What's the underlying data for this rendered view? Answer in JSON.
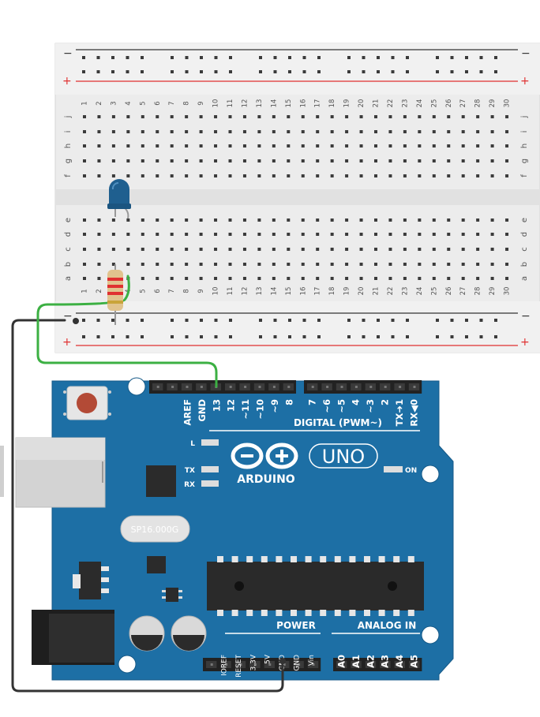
{
  "breadboard": {
    "columns": 30,
    "rows_top": [
      "j",
      "i",
      "h",
      "g",
      "f"
    ],
    "rows_bottom": [
      "e",
      "d",
      "c",
      "b",
      "a"
    ],
    "rail_minus": "−",
    "rail_plus": "+"
  },
  "components": {
    "led": {
      "color": "#1f5f8f",
      "name": "LED"
    },
    "resistor": {
      "name": "Resistor"
    }
  },
  "arduino": {
    "logo_text": "ARDUINO",
    "uno_text": "UNO",
    "digital_label": "DIGITAL (PWM~)",
    "power_label": "POWER",
    "analog_label": "ANALOG IN",
    "led_l": "L",
    "led_tx": "TX",
    "led_rx": "RX",
    "led_on": "ON",
    "crystal": "SP16.000G",
    "top_pins": [
      "AREF",
      "GND",
      "13",
      "12",
      "~11",
      "~10",
      "~9",
      "8",
      "7",
      "~6",
      "~5",
      "4",
      "~3",
      "2",
      "TX➜1",
      "RX◀0"
    ],
    "power_pins": [
      "IOREF",
      "RESET",
      "3.3V",
      "5V",
      "GND",
      "GND",
      "Vin"
    ],
    "analog_pins": [
      "A0",
      "A1",
      "A2",
      "A3",
      "A4",
      "A5"
    ]
  },
  "wires": {
    "signal_color": "#3cb043",
    "ground_color": "#333333"
  },
  "colors": {
    "board_blue": "#1d6fa5",
    "breadboard": "#eeeeee",
    "rail_red": "#e03131"
  }
}
